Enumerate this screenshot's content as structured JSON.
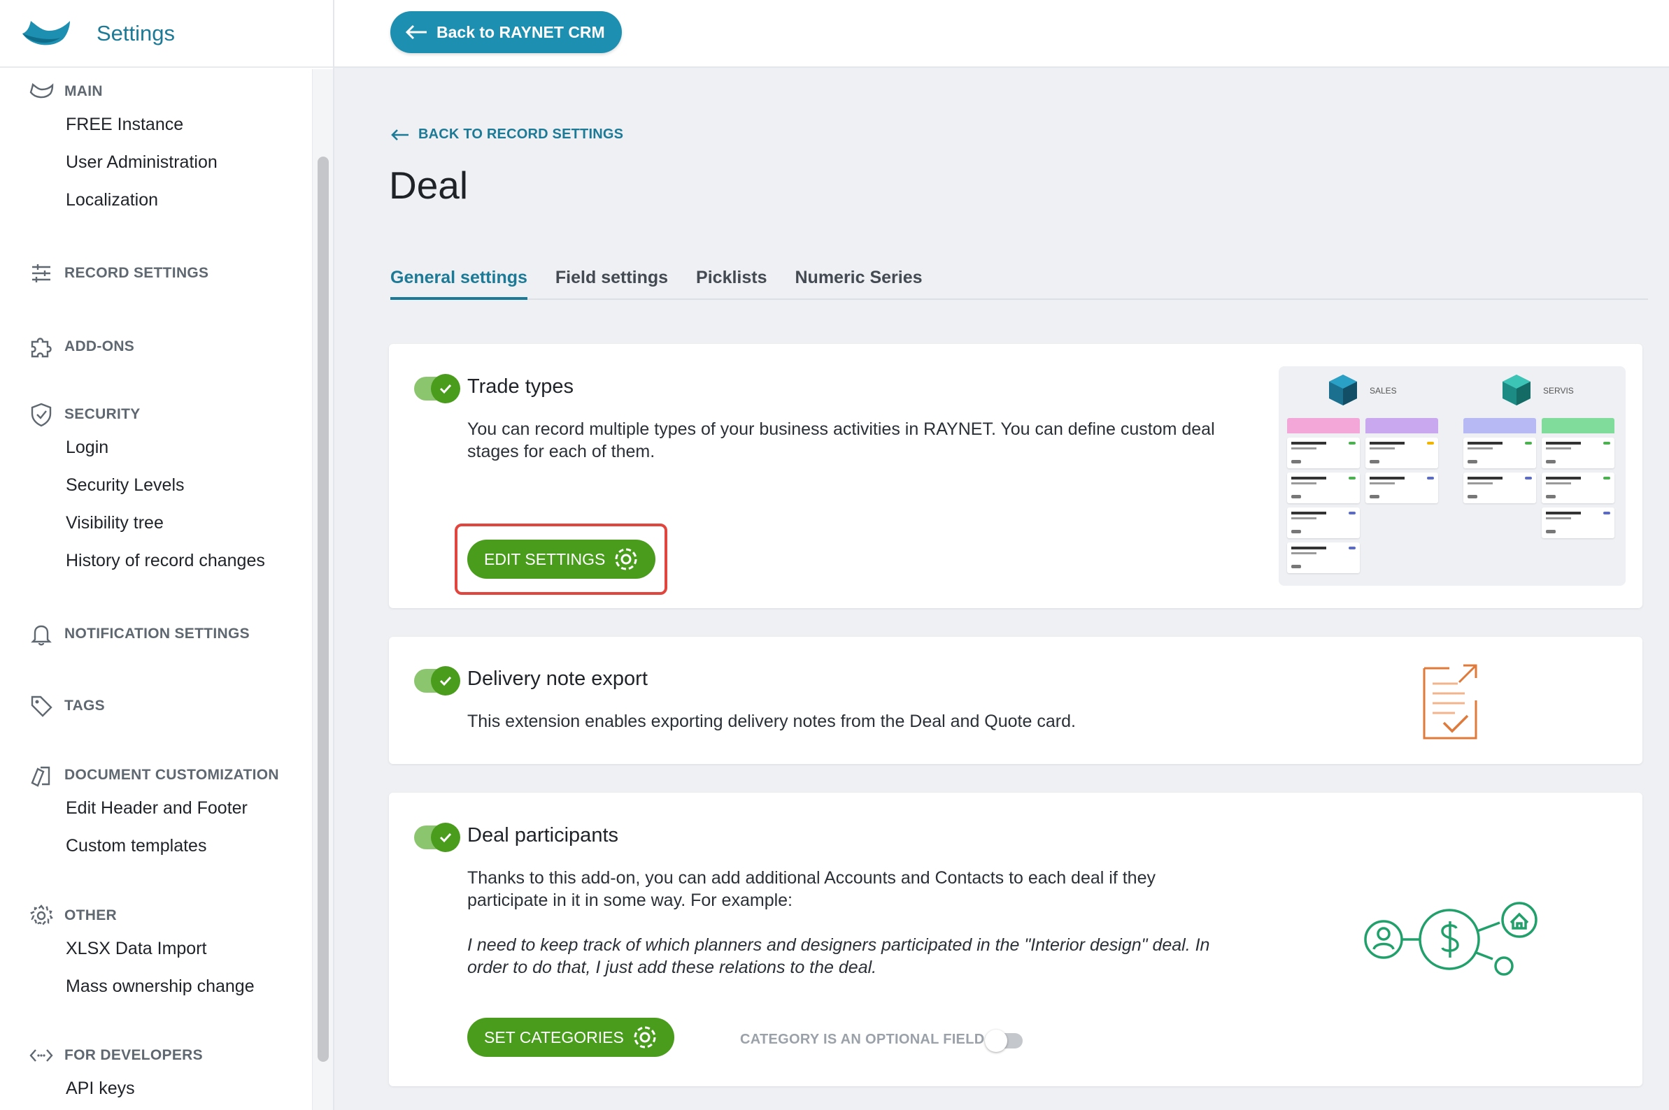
{
  "sidebar": {
    "title": "Settings",
    "sections": {
      "main": {
        "label": "MAIN",
        "items": [
          "FREE Instance",
          "User Administration",
          "Localization"
        ]
      },
      "record_settings": {
        "label": "RECORD SETTINGS"
      },
      "addons": {
        "label": "ADD-ONS"
      },
      "security": {
        "label": "SECURITY",
        "items": [
          "Login",
          "Security Levels",
          "Visibility tree",
          "History of record changes"
        ]
      },
      "notification": {
        "label": "NOTIFICATION SETTINGS"
      },
      "tags": {
        "label": "TAGS"
      },
      "document": {
        "label": "DOCUMENT CUSTOMIZATION",
        "items": [
          "Edit Header and Footer",
          "Custom templates"
        ]
      },
      "other": {
        "label": "OTHER",
        "items": [
          "XLSX Data Import",
          "Mass ownership change"
        ]
      },
      "developers": {
        "label": "FOR DEVELOPERS",
        "items": [
          "API keys"
        ]
      }
    }
  },
  "topbar": {
    "back_label": "Back to RAYNET CRM"
  },
  "main": {
    "back_link": "BACK TO RECORD SETTINGS",
    "title": "Deal",
    "tabs": [
      "General settings",
      "Field settings",
      "Picklists",
      "Numeric Series"
    ],
    "active_tab": 0
  },
  "cards": {
    "trade_types": {
      "title": "Trade types",
      "desc": "You can record multiple types of your business activities in RAYNET. You can define custom deal stages for each of them.",
      "button": "EDIT SETTINGS",
      "enabled": true,
      "preview": {
        "left_label": "SALES",
        "right_label": "SERVIS"
      }
    },
    "delivery": {
      "title": "Delivery note export",
      "desc": "This extension enables exporting delivery notes from the Deal and Quote card.",
      "enabled": true
    },
    "participants": {
      "title": "Deal participants",
      "desc": "Thanks to this add-on, you can add additional Accounts and Contacts to each deal if they participate in it in some way. For example:",
      "example": "I need to keep track of which planners and designers participated in the \"Interior design\" deal. In order to do that, I just add these relations to the deal.",
      "button": "SET CATEGORIES",
      "optional_label": "CATEGORY IS AN OPTIONAL FIELD",
      "optional_enabled": false,
      "enabled": true
    }
  },
  "colors": {
    "accent": "#1d7a96",
    "button_blue": "#1d8fb1",
    "green": "#4a9d1c",
    "highlight": "#e0463e",
    "delivery_icon": "#e07a3a",
    "participants_icon": "#22a06b"
  }
}
